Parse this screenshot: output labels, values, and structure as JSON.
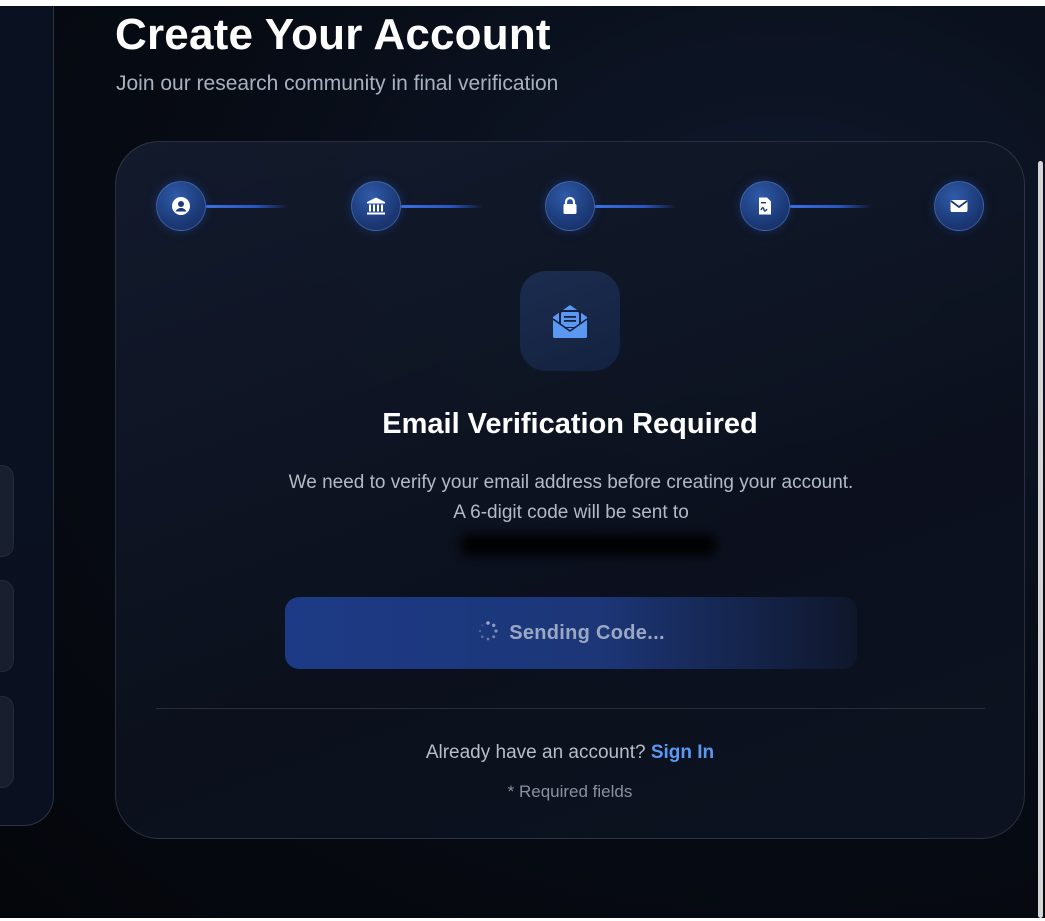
{
  "header": {
    "title": "Create Your Account",
    "subtitle": "Join our research community in final verification"
  },
  "steps": [
    {
      "name": "profile",
      "icon": "user-circle-icon"
    },
    {
      "name": "institution",
      "icon": "bank-icon"
    },
    {
      "name": "security",
      "icon": "lock-icon"
    },
    {
      "name": "documents",
      "icon": "document-signature-icon"
    },
    {
      "name": "email",
      "icon": "envelope-icon"
    }
  ],
  "verification": {
    "icon": "envelope-open-text-icon",
    "title": "Email Verification Required",
    "description": "We need to verify your email address before creating your account. A 6-digit code will be sent to",
    "button_label": "Sending Code...",
    "button_state": "loading"
  },
  "footer": {
    "signin_prompt": "Already have an account?",
    "signin_link": "Sign In",
    "required_note": "* Required fields"
  },
  "colors": {
    "accent": "#5a98f2",
    "step_fill": "#1c3a78",
    "button": "#1d3a86",
    "background": "#070b14"
  }
}
